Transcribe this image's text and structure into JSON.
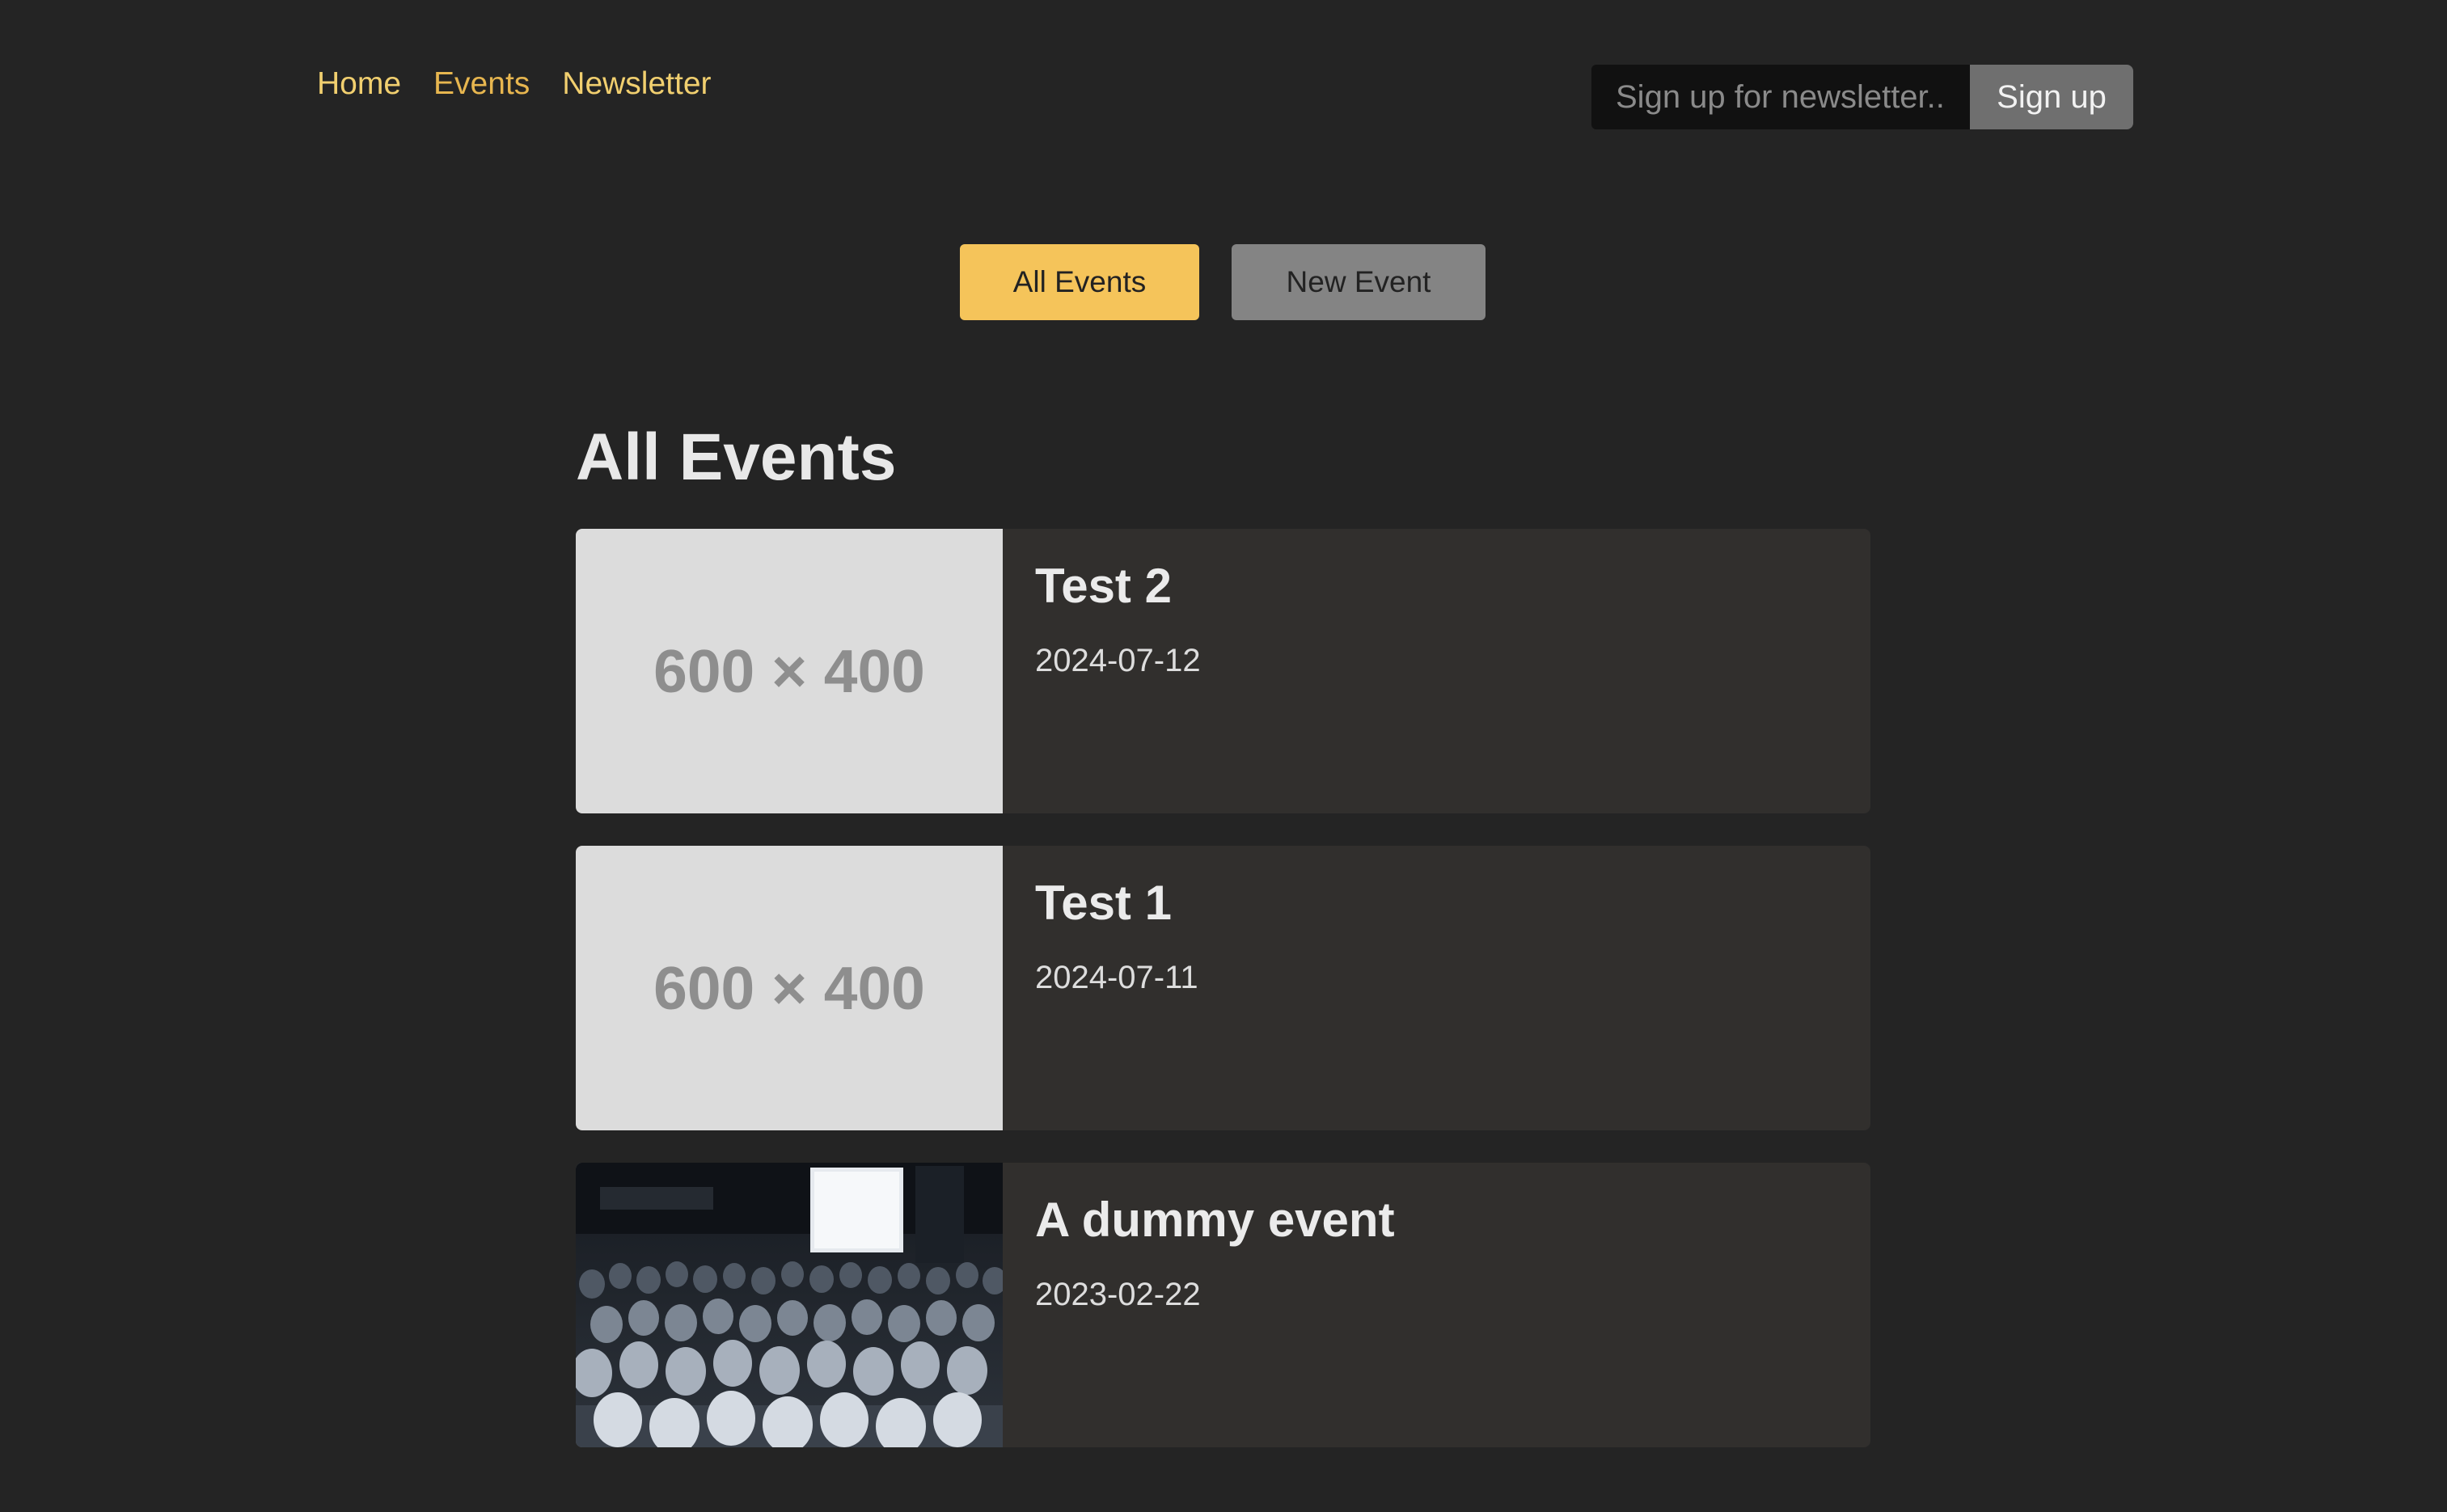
{
  "nav": {
    "items": [
      {
        "label": "Home",
        "active": false
      },
      {
        "label": "Events",
        "active": true
      },
      {
        "label": "Newsletter",
        "active": false
      }
    ]
  },
  "newsletter": {
    "placeholder": "Sign up for newsletter..",
    "value": "",
    "button_label": "Sign up"
  },
  "tabs": {
    "all_events": "All Events",
    "new_event": "New Event",
    "selected": "All Events"
  },
  "page": {
    "title": "All Events"
  },
  "events": [
    {
      "title": "Test 2",
      "date": "2024-07-12",
      "image_placeholder": "600 × 400",
      "has_photo": false
    },
    {
      "title": "Test 1",
      "date": "2024-07-11",
      "image_placeholder": "600 × 400",
      "has_photo": false
    },
    {
      "title": "A dummy event",
      "date": "2023-02-22",
      "image_placeholder": "",
      "has_photo": true,
      "photo_description": "black-and-white crowd at a conference"
    }
  ],
  "colors": {
    "background": "#242424",
    "accent": "#f5c45a",
    "nav_link": "#f1cf6f",
    "card_background": "#312f2d",
    "secondary_button": "#848484",
    "placeholder_image": "#dcdcdc"
  }
}
